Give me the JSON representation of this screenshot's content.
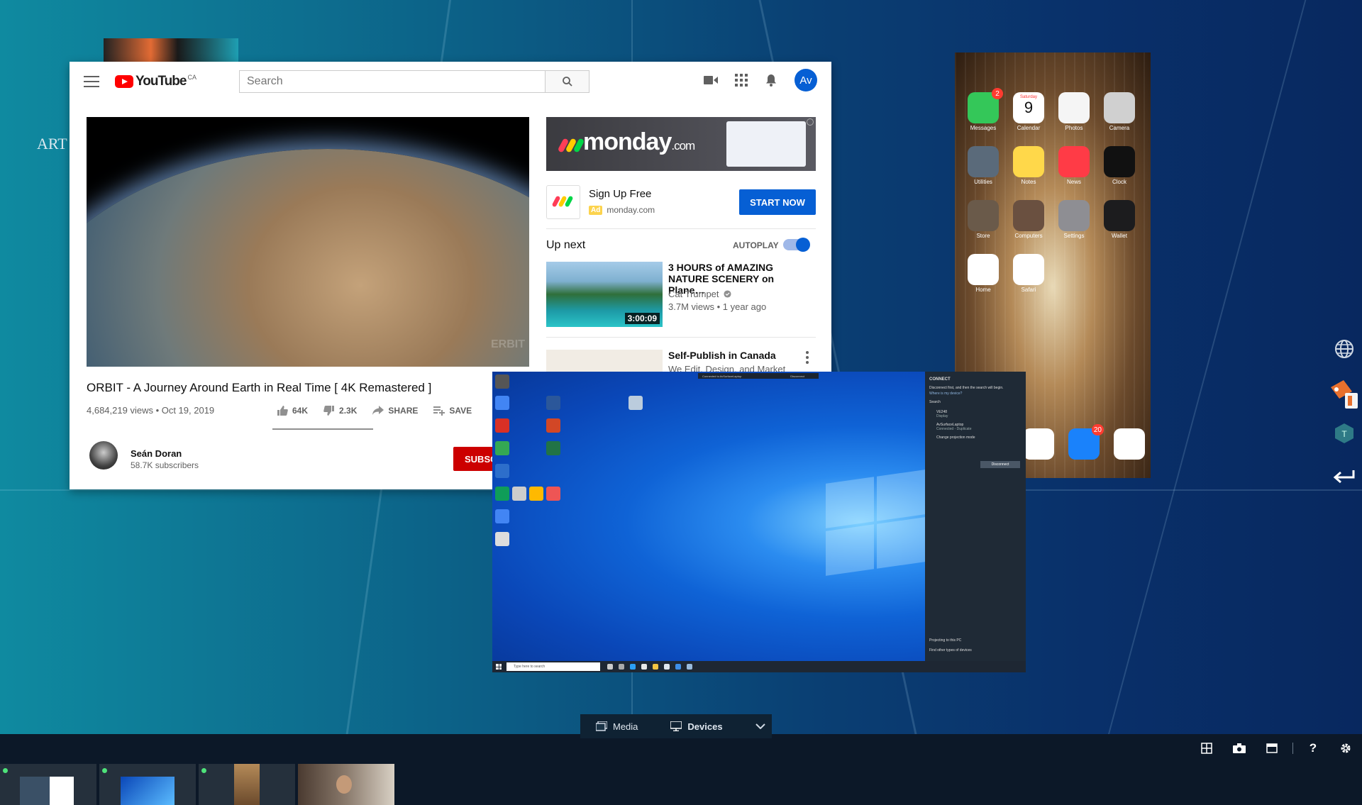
{
  "colors": {
    "accent": "#065fd4",
    "youtube_red": "#ff0000",
    "subscribe_red": "#cc0000",
    "online_dot": "#4ee37a"
  },
  "background": {
    "partial_text": "ART"
  },
  "youtube": {
    "logo_text": "YouTube",
    "region": "CA",
    "search": {
      "placeholder": "Search"
    },
    "avatar_initials": "Av",
    "video": {
      "title": "ORBIT - A Journey Around Earth in Real Time [ 4K Remastered ]",
      "views_date": "4,684,219 views • Oct 19, 2019",
      "likes": "64K",
      "dislikes": "2.3K",
      "share_label": "SHARE",
      "save_label": "SAVE",
      "watermark": "ERBIT"
    },
    "channel": {
      "name": "Seán Doran",
      "subscribers": "58.7K subscribers",
      "subscribe_label": "SUBSC"
    },
    "ad": {
      "brand": "monday",
      "brand_suffix": ".com",
      "title": "Sign Up Free",
      "tag": "Ad",
      "domain": "monday.com",
      "cta": "START NOW"
    },
    "up_next_label": "Up next",
    "autoplay_label": "AUTOPLAY",
    "autoplay_on": true,
    "related": [
      {
        "title": "3 HOURS of AMAZING NATURE SCENERY on Plane…",
        "channel": "Cat Trumpet",
        "views_age": "3.7M views • 1 year ago",
        "duration": "3:00:09"
      },
      {
        "title": "Self-Publish in Canada",
        "channel": "We Edit, Design, and Market"
      }
    ]
  },
  "ipad": {
    "apps": [
      {
        "label": "Messages",
        "color": "#34c759",
        "badge": "2"
      },
      {
        "label": "Calendar",
        "color": "#ffffff",
        "day": "Saturday",
        "date": "9"
      },
      {
        "label": "Photos",
        "color": "#f5f5f5"
      },
      {
        "label": "Camera",
        "color": "#d0d0d0"
      },
      {
        "label": "Utilities",
        "color": "#5a6a7a"
      },
      {
        "label": "Notes",
        "color": "#ffd84a"
      },
      {
        "label": "News",
        "color": "#ff3b46"
      },
      {
        "label": "Clock",
        "color": "#111111"
      },
      {
        "label": "Store",
        "color": "#6a5a4a"
      },
      {
        "label": "Computers",
        "color": "#6a5040"
      },
      {
        "label": "Settings",
        "color": "#8e8e93"
      },
      {
        "label": "Wallet",
        "color": "#1c1c1e"
      },
      {
        "label": "Home",
        "color": "#ffffff"
      },
      {
        "label": "Safari",
        "color": "#ffffff"
      }
    ],
    "dock": [
      {
        "name": "chrome",
        "color": "#ffffff"
      },
      {
        "name": "mail",
        "color": "#1a82fb",
        "badge": "20"
      },
      {
        "name": "music",
        "color": "#ffffff"
      }
    ]
  },
  "windows": {
    "banner": "Connected to AvSurfaceLaptop",
    "banner_action": "Disconnect",
    "taskbar_search": "Type here to search",
    "connect_panel": {
      "title": "CONNECT",
      "line1": "Disconnect first, and then the search will begin.",
      "line2": "Where is my device?",
      "search": "Search",
      "device1": "VE248",
      "device1_type": "Display",
      "device2": "AvSurfaceLaptop",
      "device2_status": "Connected - Duplicate",
      "change_mode": "Change projection mode",
      "disconnect": "Disconnect",
      "footer1": "Projecting to this PC",
      "footer2": "Find other types of devices"
    }
  },
  "bottom_tabs": [
    {
      "label": "Media"
    },
    {
      "label": "Devices"
    }
  ]
}
